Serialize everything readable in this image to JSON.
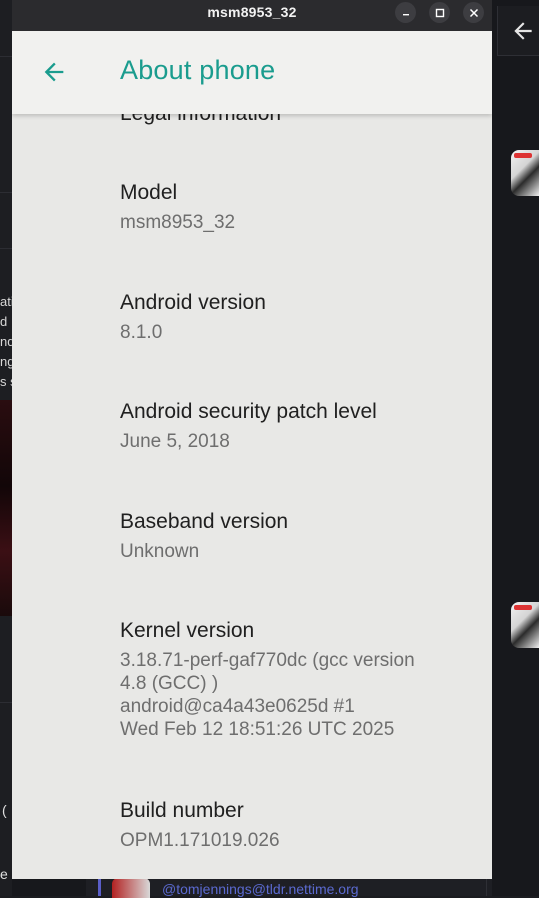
{
  "window": {
    "title": "msm8953_32"
  },
  "appbar": {
    "title": "About phone",
    "accent_color": "#1a9c8e"
  },
  "items": [
    {
      "title": "Legal information",
      "summary": []
    },
    {
      "title": "Model",
      "summary": [
        "msm8953_32"
      ]
    },
    {
      "title": "Android version",
      "summary": [
        "8.1.0"
      ]
    },
    {
      "title": "Android security patch level",
      "summary": [
        "June 5, 2018"
      ]
    },
    {
      "title": "Baseband version",
      "summary": [
        "Unknown"
      ]
    },
    {
      "title": "Kernel version",
      "summary": [
        "3.18.71-perf-gaf770dc (gcc version",
        "4.8 (GCC) )",
        "android@ca4a43e0625d #1",
        "Wed Feb 12 18:51:26 UTC 2025"
      ]
    },
    {
      "title": "Build number",
      "summary": [
        "OPM1.171019.026"
      ]
    }
  ],
  "background": {
    "left_text": [
      "ati",
      " d",
      "nd",
      "ng",
      "s s"
    ],
    "left_paren": "(",
    "left_e": "e",
    "bottom_handle": "@tomjennings@tldr.nettime.org"
  }
}
